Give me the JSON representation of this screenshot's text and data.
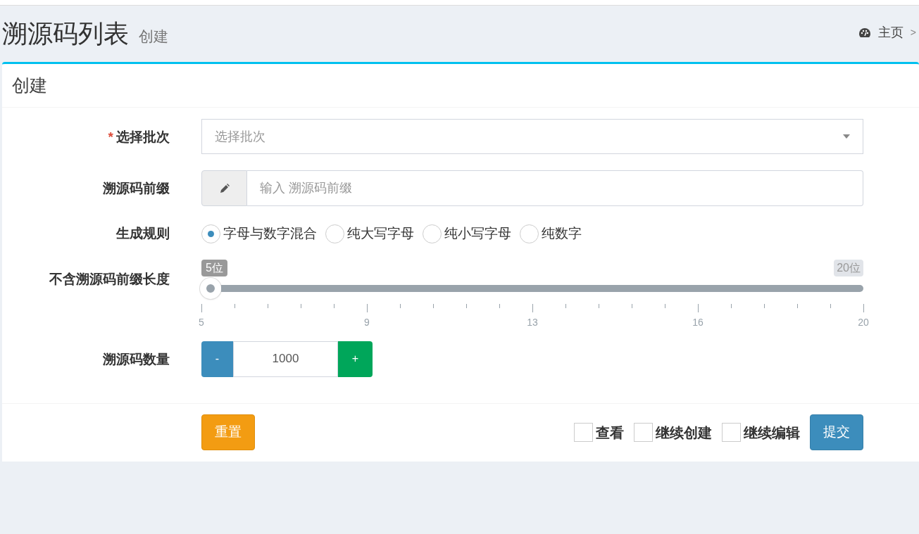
{
  "header": {
    "title": "溯源码列表",
    "subtitle": "创建",
    "breadcrumb": "主页",
    "breadcrumb_sep": ">"
  },
  "box": {
    "title": "创建"
  },
  "fields": [
    {
      "kind": "select",
      "label": "选择批次",
      "required_mark": "*",
      "placeholder": "选择批次"
    },
    {
      "kind": "input",
      "label": "溯源码前缀",
      "placeholder": "输入 溯源码前缀"
    },
    {
      "kind": "radio",
      "label": "生成规则",
      "options": [
        {
          "label": "字母与数字混合",
          "selected": true
        },
        {
          "label": "纯大写字母",
          "selected": false
        },
        {
          "label": "纯小写字母",
          "selected": false
        },
        {
          "label": "纯数字",
          "selected": false
        }
      ]
    },
    {
      "kind": "slider",
      "label": "不含溯源码前缀长度",
      "level": 0,
      "value_label": "5位",
      "max_label": "20位",
      "ticks": [
        "5",
        "9",
        "13",
        "16",
        "20"
      ]
    },
    {
      "kind": "number",
      "label": "溯源码数量",
      "value": "1000",
      "minus": "-",
      "plus": "+"
    }
  ],
  "footer": {
    "reset": "重置",
    "checks": [
      {
        "label": "查看",
        "checked": false
      },
      {
        "label": "继续创建",
        "checked": false
      },
      {
        "label": "继续编辑",
        "checked": false
      }
    ],
    "submit": "提交"
  }
}
